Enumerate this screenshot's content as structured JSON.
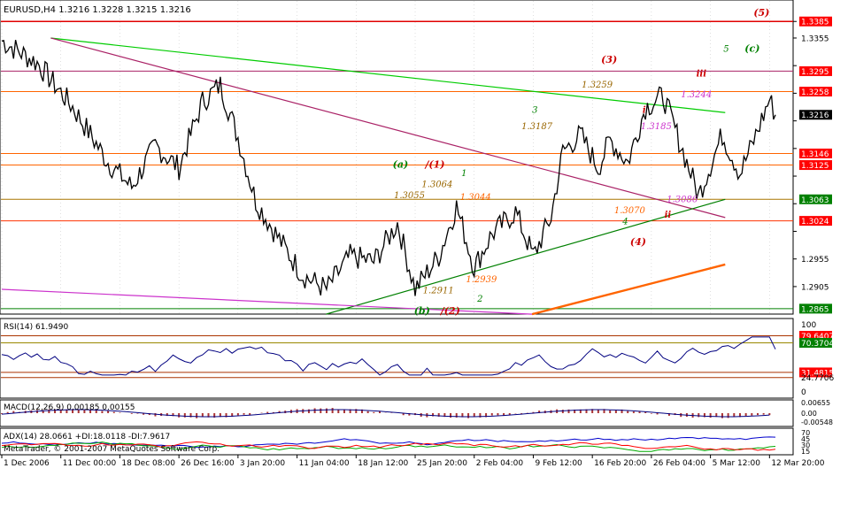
{
  "window": {
    "symbol_header": "EURUSD,H4  1.3216 1.3228 1.3215 1.3216",
    "copyright": "MetaTrader, © 2001-2007 MetaQuotes Software Corp."
  },
  "colors": {
    "background": "#ffffff",
    "price_line": "#000000",
    "grid": "#c0c0c0",
    "resistance_red": "#ff0000",
    "support_orange": "#ff6400",
    "trend_green": "#00cc00",
    "trend_dark_green": "#008000",
    "trend_purple": "#aa2266",
    "trend_magenta": "#cc33cc",
    "current_price_box": "#000000",
    "label_box_red": "#ff0000",
    "label_box_green": "#008000",
    "rsi_line": "#000080",
    "macd_hist": "#aa3333",
    "adx_line": "#0000cc",
    "di_plus": "#00aa00",
    "di_minus": "#ff0000"
  },
  "chart_data": {
    "type": "line",
    "symbol": "EURUSD",
    "timeframe": "H4",
    "last_ohlc": {
      "open": 1.3216,
      "high": 1.3228,
      "low": 1.3215,
      "close": 1.3216
    },
    "x_ticks": [
      "1 Dec 2006",
      "11 Dec 00:00",
      "18 Dec 08:00",
      "26 Dec 16:00",
      "3 Jan 20:00",
      "11 Jan 04:00",
      "18 Jan 12:00",
      "25 Jan 20:00",
      "2 Feb 04:00",
      "9 Feb 12:00",
      "16 Feb 20:00",
      "26 Feb 04:00",
      "5 Mar 12:00",
      "12 Mar 20:00"
    ],
    "y_ticks": [
      1.3385,
      1.3355,
      1.3305,
      1.3255,
      1.3205,
      1.3155,
      1.3105,
      1.3055,
      1.3005,
      1.2955,
      1.2905
    ],
    "ylim": [
      1.286,
      1.3395
    ],
    "price_path": [
      [
        0,
        1.335
      ],
      [
        6,
        1.331
      ],
      [
        12,
        1.323
      ],
      [
        18,
        1.313
      ],
      [
        22,
        1.3085
      ],
      [
        26,
        1.316
      ],
      [
        30,
        1.312
      ],
      [
        34,
        1.324
      ],
      [
        37,
        1.327
      ],
      [
        40,
        1.3175
      ],
      [
        43,
        1.306
      ],
      [
        47,
        1.299
      ],
      [
        51,
        1.2925
      ],
      [
        55,
        1.29
      ],
      [
        59,
        1.296
      ],
      [
        63,
        1.295
      ],
      [
        67,
        1.302
      ],
      [
        70,
        1.29
      ],
      [
        74,
        1.296
      ],
      [
        77,
        1.305
      ],
      [
        80,
        1.294
      ],
      [
        83,
        1.3
      ],
      [
        87,
        1.304
      ],
      [
        90,
        1.296
      ],
      [
        93,
        1.303
      ],
      [
        95,
        1.315
      ],
      [
        98,
        1.318
      ],
      [
        101,
        1.312
      ],
      [
        103,
        1.317
      ],
      [
        106,
        1.313
      ],
      [
        109,
        1.323
      ],
      [
        112,
        1.325
      ],
      [
        115,
        1.316
      ],
      [
        118,
        1.307
      ],
      [
        122,
        1.318
      ],
      [
        125,
        1.311
      ],
      [
        127,
        1.316
      ],
      [
        130,
        1.3244
      ],
      [
        131,
        1.3216
      ]
    ],
    "levels": [
      {
        "label": "1.3385",
        "value": 1.3385,
        "style": "red-box",
        "line": "#e00000"
      },
      {
        "label": "1.3295",
        "value": 1.3295,
        "style": "red-box",
        "line": "#aa2266"
      },
      {
        "label": "1.3258",
        "value": 1.3258,
        "style": "red-box",
        "line": "#ff6400"
      },
      {
        "label": "1.3216",
        "value": 1.3216,
        "style": "black-box",
        "line": ""
      },
      {
        "label": "1.3146",
        "value": 1.3146,
        "style": "red-box",
        "line": "#ff6400"
      },
      {
        "label": "1.3125",
        "value": 1.3125,
        "style": "red-box",
        "line": "#ff6400"
      },
      {
        "label": "1.3063",
        "value": 1.3063,
        "style": "green-box",
        "line": "#aa7700"
      },
      {
        "label": "1.3024",
        "value": 1.3024,
        "style": "red-box",
        "line": "#ff3300"
      },
      {
        "label": "1.2865",
        "value": 1.2865,
        "style": "green-box",
        "line": "#008000"
      }
    ],
    "annotations": [
      {
        "text": "(5)",
        "x": 127.3,
        "y": 1.3395,
        "color": "#cc0000",
        "italic": true
      },
      {
        "text": "5",
        "x": 122.2,
        "y": 1.333,
        "color": "#008000",
        "italic": true
      },
      {
        "text": "(c)",
        "x": 125.8,
        "y": 1.333,
        "color": "#008000",
        "italic": true
      },
      {
        "text": "(3)",
        "x": 101.5,
        "y": 1.331,
        "color": "#cc0000",
        "italic": true
      },
      {
        "text": "iii",
        "x": 117.6,
        "y": 1.3285,
        "color": "#cc0000",
        "italic": true
      },
      {
        "text": "1.3259",
        "x": 98.2,
        "y": 1.3265,
        "color": "#996600",
        "italic": true
      },
      {
        "text": "1.3244",
        "x": 115.0,
        "y": 1.3248,
        "color": "#cc33cc",
        "italic": true
      },
      {
        "text": "i",
        "x": 108.5,
        "y": 1.322,
        "color": "#cc0000",
        "italic": true
      },
      {
        "text": "3",
        "x": 89.8,
        "y": 1.322,
        "color": "#008000",
        "italic": true
      },
      {
        "text": "1.3187",
        "x": 88.0,
        "y": 1.319,
        "color": "#996600",
        "italic": true
      },
      {
        "text": "1.3185",
        "x": 108.2,
        "y": 1.319,
        "color": "#cc33cc",
        "italic": true
      },
      {
        "text": "(a)",
        "x": 66.2,
        "y": 1.312,
        "color": "#008000",
        "italic": true
      },
      {
        "text": "/(1)",
        "x": 71.7,
        "y": 1.312,
        "color": "#cc0000",
        "italic": true
      },
      {
        "text": "1",
        "x": 77.8,
        "y": 1.3105,
        "color": "#008000",
        "italic": true
      },
      {
        "text": "1.3064",
        "x": 71.1,
        "y": 1.3085,
        "color": "#996600",
        "italic": true
      },
      {
        "text": "1.3055",
        "x": 66.4,
        "y": 1.3065,
        "color": "#996600",
        "italic": true
      },
      {
        "text": "1.3044",
        "x": 77.6,
        "y": 1.3062,
        "color": "#ff6400",
        "italic": true
      },
      {
        "text": "1.3086",
        "x": 112.6,
        "y": 1.3058,
        "color": "#cc33cc",
        "italic": true
      },
      {
        "text": "1.3070",
        "x": 103.7,
        "y": 1.3038,
        "color": "#ff6400",
        "italic": true
      },
      {
        "text": "ii",
        "x": 112.2,
        "y": 1.303,
        "color": "#cc0000",
        "italic": true
      },
      {
        "text": "4",
        "x": 105.1,
        "y": 1.3018,
        "color": "#008000",
        "italic": true
      },
      {
        "text": "(4)",
        "x": 106.4,
        "y": 1.298,
        "color": "#cc0000",
        "italic": true
      },
      {
        "text": "1.2939",
        "x": 78.6,
        "y": 1.2913,
        "color": "#ff6400",
        "italic": true
      },
      {
        "text": "1.2911",
        "x": 71.3,
        "y": 1.2893,
        "color": "#996600",
        "italic": true
      },
      {
        "text": "2",
        "x": 80.5,
        "y": 1.2878,
        "color": "#008000",
        "italic": true
      },
      {
        "text": "(b)",
        "x": 69.8,
        "y": 1.2855,
        "color": "#008000",
        "italic": true
      },
      {
        "text": "/(2)",
        "x": 74.3,
        "y": 1.2855,
        "color": "#cc0000",
        "italic": true
      }
    ],
    "trendlines": [
      {
        "name": "green-resistance",
        "from": [
          8.3,
          1.3355
        ],
        "to": [
          122.5,
          1.322
        ],
        "color": "#00cc00"
      },
      {
        "name": "purple-resistance",
        "from": [
          8.3,
          1.3355
        ],
        "to": [
          122.5,
          1.303
        ],
        "color": "#aa2266"
      },
      {
        "name": "green-support",
        "from": [
          54.9,
          1.2855
        ],
        "to": [
          122.5,
          1.3063
        ],
        "color": "#008000"
      },
      {
        "name": "magenta-base",
        "from": [
          0.0,
          1.29
        ],
        "to": [
          89.8,
          1.2855
        ],
        "color": "#cc33cc"
      },
      {
        "name": "orange-channel",
        "from": [
          89.8,
          1.2855
        ],
        "to": [
          122.5,
          1.2945
        ],
        "color": "#ff6400"
      }
    ],
    "indicators": [
      {
        "name": "RSI(14) 61.9490",
        "ylim": [
          0,
          100
        ],
        "levels": [
          {
            "label": "79.6407",
            "value": 79.6407,
            "box": "red"
          },
          {
            "label": "70.3704",
            "value": 70.3704,
            "box": "green"
          },
          {
            "label": "31.4815",
            "value": 31.4815,
            "box": "red"
          },
          {
            "label": "24.7706",
            "value": 24.7706,
            "box": "none"
          }
        ],
        "ticks": [
          "100",
          "0"
        ]
      },
      {
        "name": "MACD(12,26,9) 0.00185 0.00155",
        "ticks": [
          "0.00655",
          "0.00",
          "-0.00548"
        ]
      },
      {
        "name": "ADX(14) 28.0661 +DI:18.0118 -DI:7.9617",
        "ticks": [
          "70",
          "45",
          "30",
          "15"
        ]
      }
    ]
  }
}
